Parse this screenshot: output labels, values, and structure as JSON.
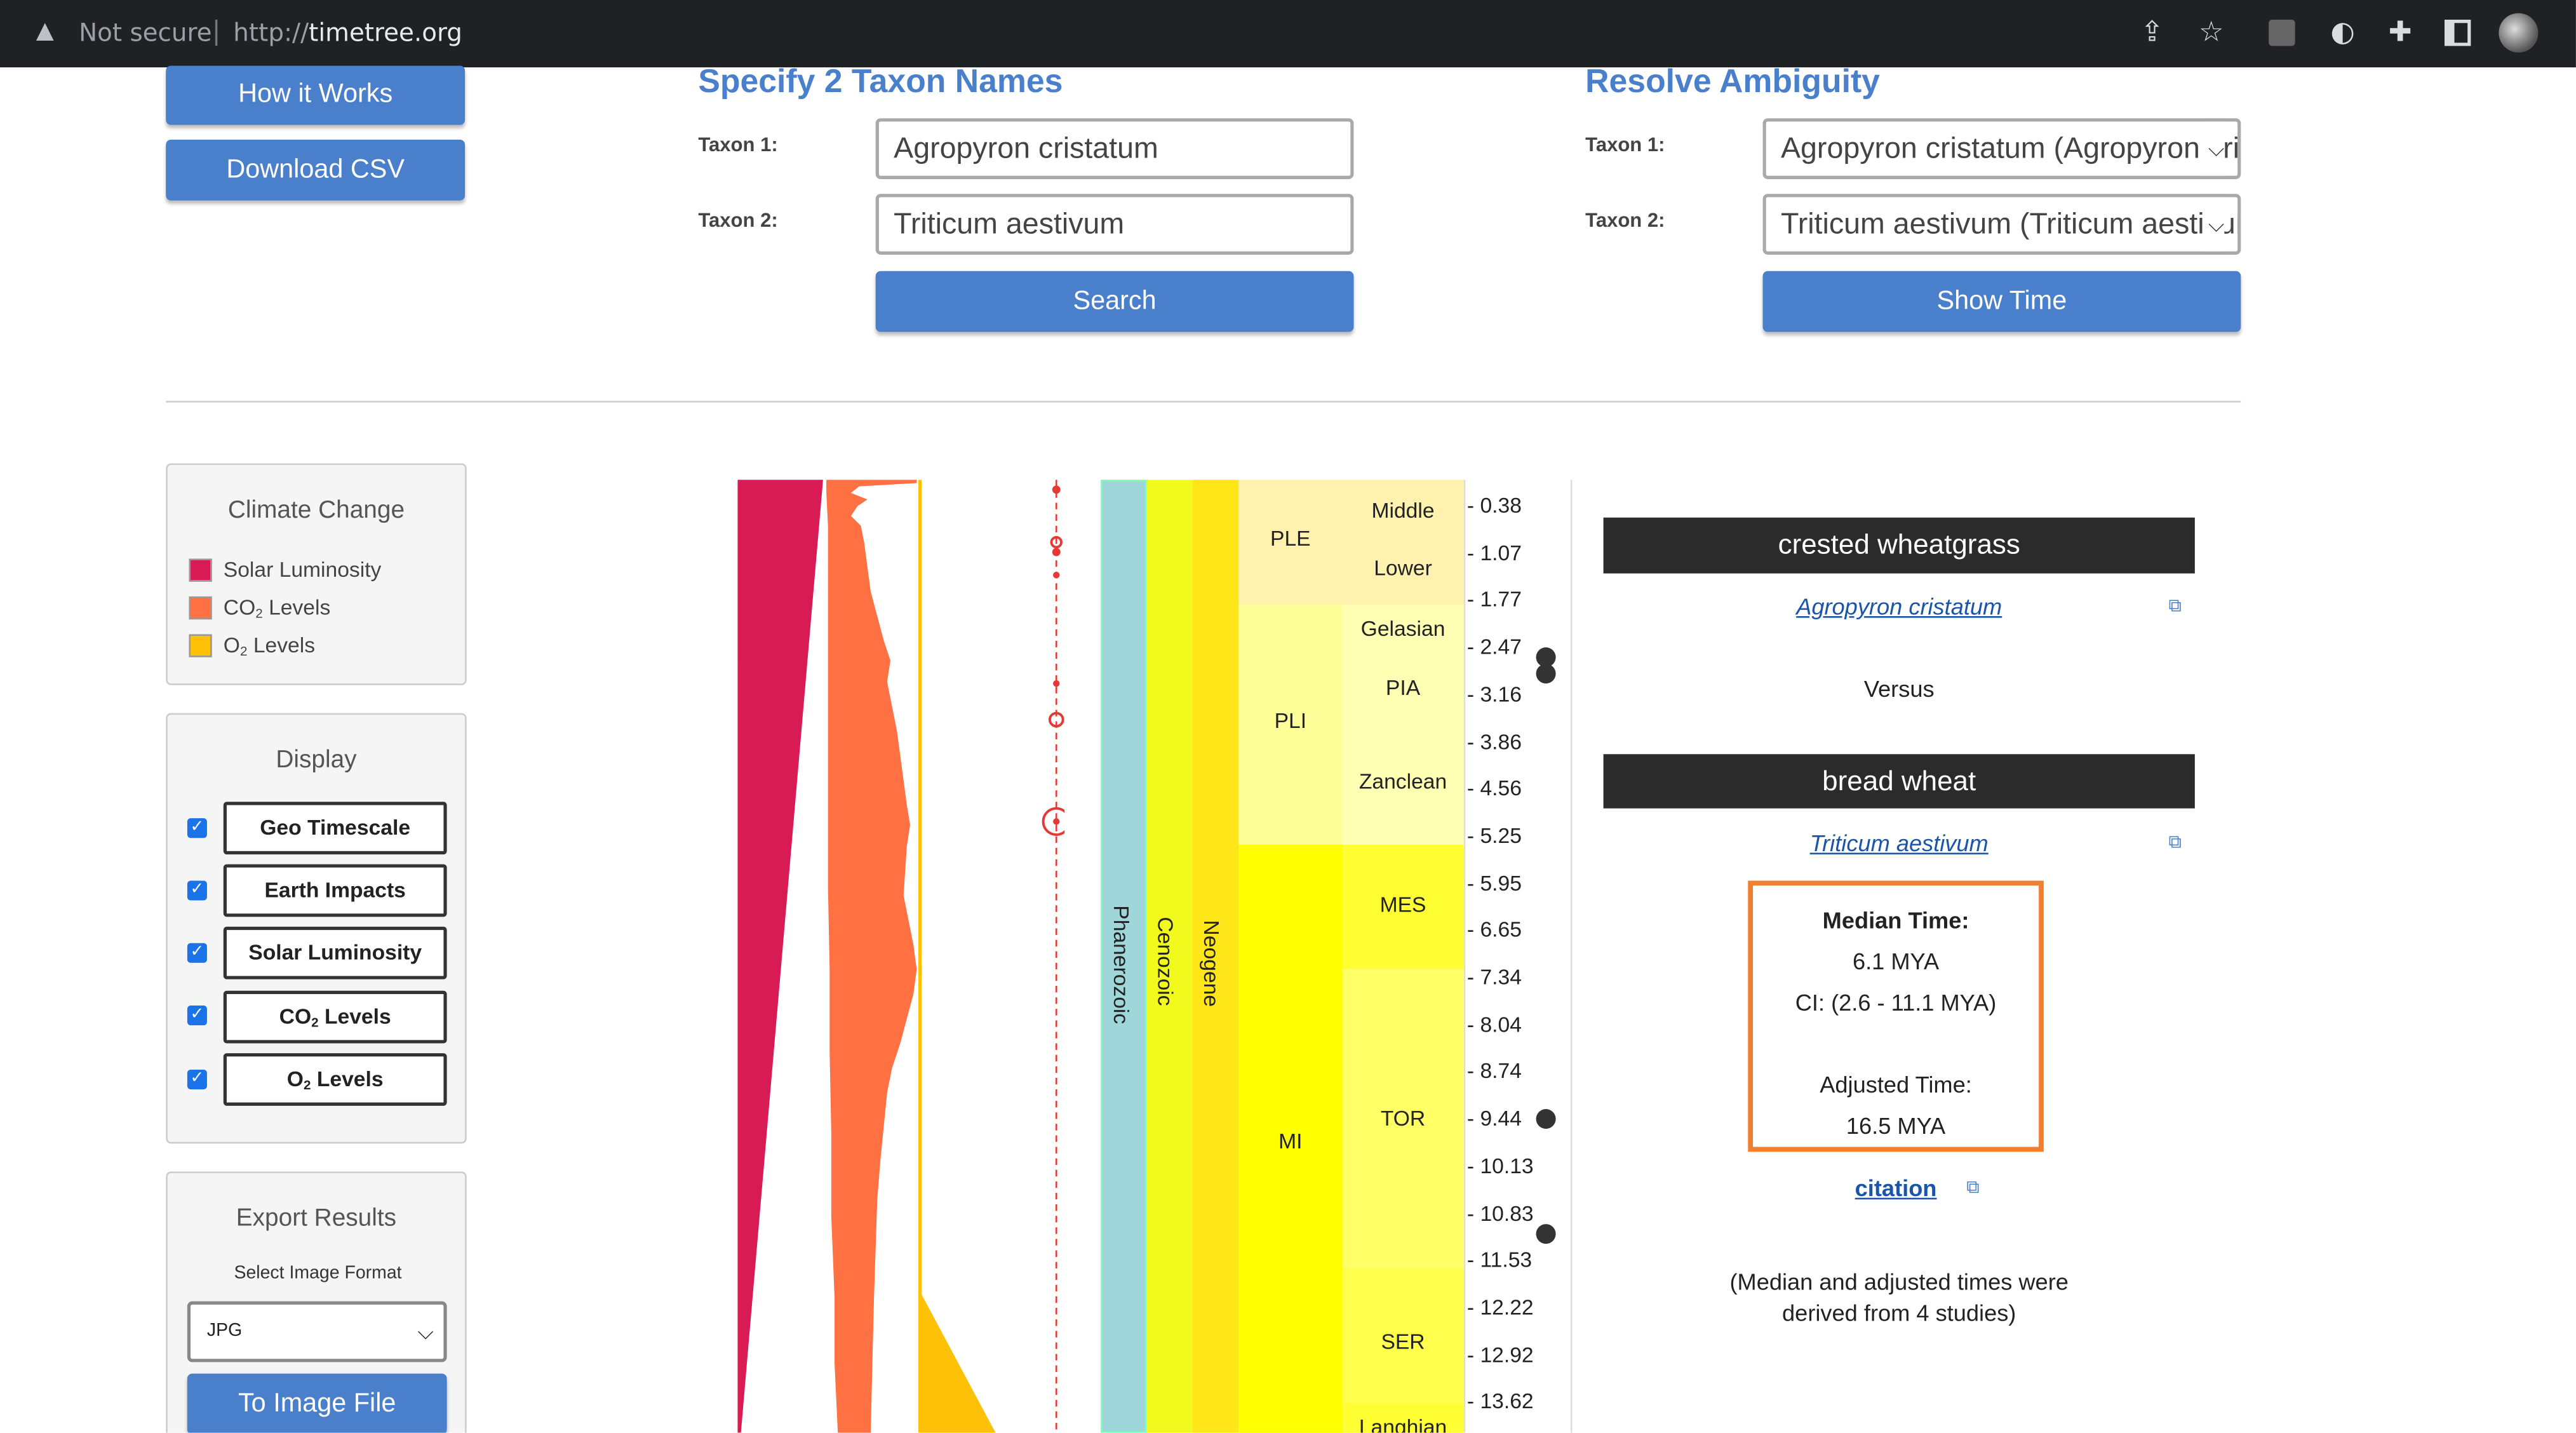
{
  "browser": {
    "security": "Not secure",
    "url_scheme": "http://",
    "url_host": "timetree.org",
    "icons": [
      "share-icon",
      "star-icon",
      "extension-image-icon",
      "extension-translate-icon",
      "puzzle-icon",
      "sidebar-icon",
      "profile-icon"
    ]
  },
  "nav": {
    "how_it_works": "How it Works",
    "download_csv": "Download CSV"
  },
  "specify": {
    "title": "Specify 2 Taxon Names",
    "taxon1_label": "Taxon 1:",
    "taxon1_value": "Agropyron cristatum",
    "taxon2_label": "Taxon 2:",
    "taxon2_value": "Triticum aestivum",
    "search": "Search"
  },
  "resolve": {
    "title": "Resolve Ambiguity",
    "taxon1_label": "Taxon 1:",
    "taxon1_value": "Agropyron cristatum (Agropyron cristatum)",
    "taxon2_label": "Taxon 2:",
    "taxon2_value": "Triticum aestivum (Triticum aestivum)",
    "show_time": "Show Time"
  },
  "climate": {
    "title": "Climate Change",
    "items": [
      {
        "label": "Solar Luminosity",
        "color": "#d81b55"
      },
      {
        "label": "CO",
        "sub": "2",
        "label2": " Levels",
        "color": "#ff7043"
      },
      {
        "label": "O",
        "sub": "2",
        "label2": " Levels",
        "color": "#ffc107"
      }
    ]
  },
  "display": {
    "title": "Display",
    "toggles": [
      {
        "label": "Geo Timescale",
        "checked": true
      },
      {
        "label": "Earth Impacts",
        "checked": true
      },
      {
        "label": "Solar Luminosity",
        "checked": true
      },
      {
        "label": "CO",
        "sub": "2",
        "label2": " Levels",
        "checked": true
      },
      {
        "label": "O",
        "sub": "2",
        "label2": " Levels",
        "checked": true
      }
    ]
  },
  "export": {
    "title": "Export Results",
    "format_label": "Select Image Format",
    "format_value": "JPG",
    "button": "To Image File"
  },
  "timescale": {
    "eon": "Phanerozoic",
    "era": "Cenozoic",
    "period": "Neogene",
    "epochs": [
      "PLE",
      "PLI",
      "MI"
    ],
    "stages": [
      "Middle",
      "Lower",
      "Gelasian",
      "PIA",
      "Zanclean",
      "MES",
      "TOR",
      "SER",
      "Langhian"
    ],
    "ticks": [
      "- 0.38",
      "- 1.07",
      "- 1.77",
      "- 2.47",
      "- 3.16",
      "- 3.86",
      "- 4.56",
      "- 5.25",
      "- 5.95",
      "- 6.65",
      "- 7.34",
      "- 8.04",
      "- 8.74",
      "- 9.44",
      "- 10.13",
      "- 10.83",
      "- 11.53",
      "- 12.22",
      "- 12.92",
      "- 13.62"
    ],
    "colors": {
      "eon": "#9ed6d9",
      "era": "#f2f91d",
      "period": "#ffe619",
      "ple": "#fff2ae",
      "pli": "#ffff99",
      "mi": "#ffff00",
      "mi_light": "#ffff66",
      "solar": "#d81b55",
      "co2": "#ff7043",
      "o2": "#ffc107",
      "impact": "#e53935"
    }
  },
  "result": {
    "taxon1_common": "crested wheatgrass",
    "taxon1_sci": "Agropyron cristatum",
    "versus": "Versus",
    "taxon2_common": "bread wheat",
    "taxon2_sci": "Triticum aestivum",
    "median_label": "Median Time:",
    "median_value": "6.1 MYA",
    "ci": "CI: (2.6 - 11.1 MYA)",
    "adjusted_label": "Adjusted Time:",
    "adjusted_value": "16.5 MYA",
    "citation": "citation",
    "note": "(Median and adjusted times were derived from 4 studies)",
    "highlight_color": "#f08030"
  }
}
